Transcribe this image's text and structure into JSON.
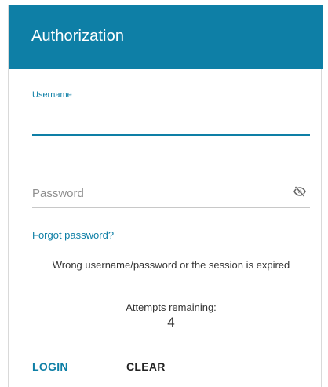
{
  "dialog": {
    "title": "Authorization"
  },
  "username": {
    "label": "Username",
    "value": ""
  },
  "password": {
    "placeholder": "Password",
    "value": "",
    "visibility_icon": "eye-off-icon"
  },
  "forgot_password_label": "Forgot password?",
  "error_message": "Wrong username/password or the session is expired",
  "attempts": {
    "label": "Attempts remaining:",
    "count": "4"
  },
  "buttons": {
    "login_label": "LOGIN",
    "clear_label": "CLEAR"
  },
  "colors": {
    "header_bg": "#0e7fa6",
    "accent": "#0e7fa6",
    "text": "#333333"
  }
}
